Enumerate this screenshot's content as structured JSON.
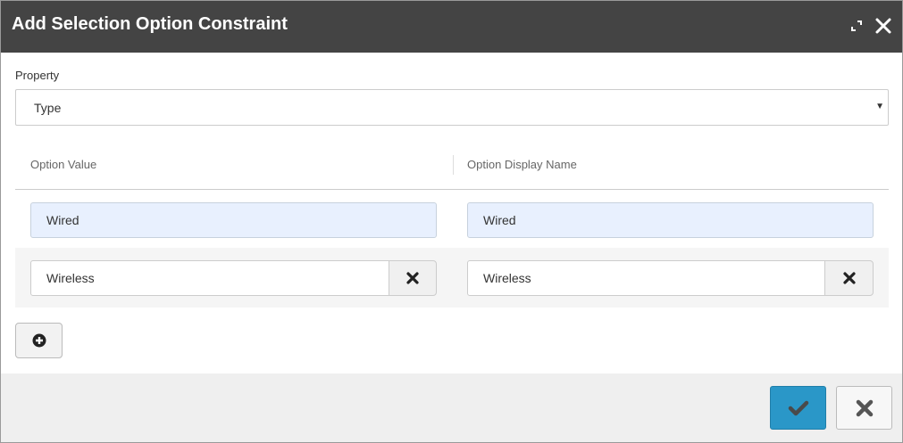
{
  "dialog": {
    "title": "Add Selection Option Constraint",
    "maximize_icon": "maximize-icon",
    "close_icon": "close-icon"
  },
  "property": {
    "label": "Property",
    "selected": "Type"
  },
  "table": {
    "headers": [
      "Option Value",
      "Option Display Name"
    ],
    "rows": [
      {
        "value": "Wired",
        "display_name": "Wired",
        "removable": false
      },
      {
        "value": "Wireless",
        "display_name": "Wireless",
        "removable": true
      }
    ]
  },
  "actions": {
    "add_icon": "plus-circle-icon",
    "ok_icon": "checkmark-icon",
    "cancel_icon": "x-icon"
  },
  "colors": {
    "header_bg": "#444444",
    "ok_button": "#2a97c8",
    "readonly_input": "#e8f0fe"
  }
}
